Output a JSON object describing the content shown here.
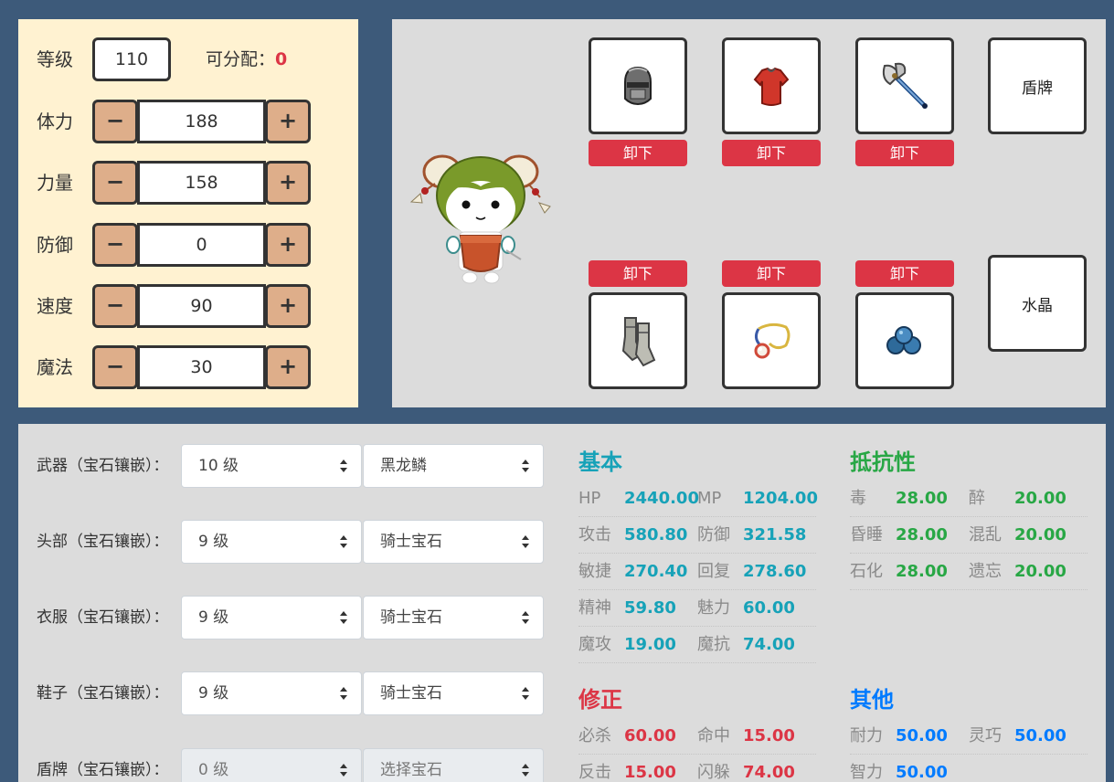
{
  "stats": {
    "level_label": "等级",
    "level_value": "110",
    "available_label": "可分配：",
    "available_value": "0",
    "minus": "−",
    "plus": "+",
    "rows": [
      {
        "label": "体力",
        "value": "188"
      },
      {
        "label": "力量",
        "value": "158"
      },
      {
        "label": "防御",
        "value": "0"
      },
      {
        "label": "速度",
        "value": "90"
      },
      {
        "label": "魔法",
        "value": "30"
      }
    ]
  },
  "equipment": {
    "unequip_label": "卸下",
    "shield_slot": "盾牌",
    "crystal_slot": "水晶",
    "slots": [
      {
        "icon": "helmet-icon"
      },
      {
        "icon": "armor-icon"
      },
      {
        "icon": "axe-icon"
      },
      {
        "icon": "boots-icon"
      },
      {
        "icon": "necklace-icon"
      },
      {
        "icon": "gems-icon"
      }
    ]
  },
  "gems": [
    {
      "label": "武器（宝石镶嵌）：",
      "level": "10 级",
      "gem": "黑龙鳞"
    },
    {
      "label": "头部（宝石镶嵌）：",
      "level": "9 级",
      "gem": "骑士宝石"
    },
    {
      "label": "衣服（宝石镶嵌）：",
      "level": "9 级",
      "gem": "骑士宝石"
    },
    {
      "label": "鞋子（宝石镶嵌）：",
      "level": "9 级",
      "gem": "骑士宝石"
    },
    {
      "label": "盾牌（宝石镶嵌）：",
      "level": "0 级",
      "gem": "选择宝石"
    }
  ],
  "attributes": {
    "basic": {
      "title": "基本",
      "rows": [
        [
          {
            "name": "HP",
            "value": "2440.00"
          },
          {
            "name": "MP",
            "value": "1204.00"
          }
        ],
        [
          {
            "name": "攻击",
            "value": "580.80"
          },
          {
            "name": "防御",
            "value": "321.58"
          }
        ],
        [
          {
            "name": "敏捷",
            "value": "270.40"
          },
          {
            "name": "回复",
            "value": "278.60"
          }
        ],
        [
          {
            "name": "精神",
            "value": "59.80"
          },
          {
            "name": "魅力",
            "value": "60.00"
          }
        ],
        [
          {
            "name": "魔攻",
            "value": "19.00"
          },
          {
            "name": "魔抗",
            "value": "74.00"
          }
        ]
      ]
    },
    "resistance": {
      "title": "抵抗性",
      "rows": [
        [
          {
            "name": "毒",
            "value": "28.00"
          },
          {
            "name": "醉",
            "value": "20.00"
          }
        ],
        [
          {
            "name": "昏睡",
            "value": "28.00"
          },
          {
            "name": "混乱",
            "value": "20.00"
          }
        ],
        [
          {
            "name": "石化",
            "value": "28.00"
          },
          {
            "name": "遗忘",
            "value": "20.00"
          }
        ]
      ]
    },
    "modifier": {
      "title": "修正",
      "rows": [
        [
          {
            "name": "必杀",
            "value": "60.00"
          },
          {
            "name": "命中",
            "value": "15.00"
          }
        ],
        [
          {
            "name": "反击",
            "value": "15.00"
          },
          {
            "name": "闪躲",
            "value": "74.00"
          }
        ]
      ]
    },
    "other": {
      "title": "其他",
      "rows": [
        [
          {
            "name": "耐力",
            "value": "50.00"
          },
          {
            "name": "灵巧",
            "value": "50.00"
          }
        ],
        [
          {
            "name": "智力",
            "value": "50.00"
          }
        ]
      ]
    }
  },
  "colors": {
    "background": "#3d5a7a",
    "stats_panel": "#fff2d1",
    "stepper_button": "#deae8a",
    "unequip": "#dc3545",
    "basic": "#17a2b8",
    "resistance": "#28a745",
    "modifier": "#dc3545",
    "other": "#007bff"
  }
}
